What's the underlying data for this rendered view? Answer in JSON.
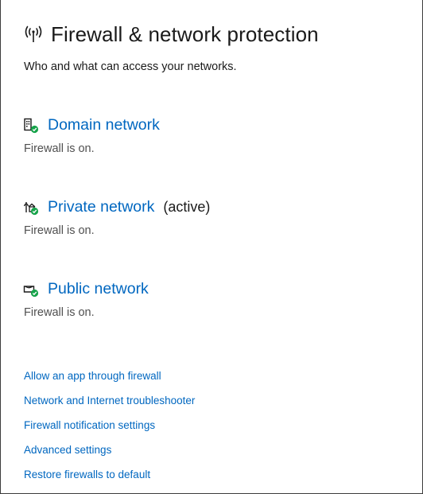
{
  "header": {
    "title": "Firewall & network protection",
    "subtitle": "Who and what can access your networks.",
    "icon": "wifi-antenna-icon"
  },
  "networks": [
    {
      "name": "Domain network",
      "active_label": "",
      "status": "Firewall is on.",
      "icon": "domain-building-icon",
      "status_color": "#16a34a"
    },
    {
      "name": "Private network",
      "active_label": "(active)",
      "status": "Firewall is on.",
      "icon": "private-home-icon",
      "status_color": "#16a34a"
    },
    {
      "name": "Public network",
      "active_label": "",
      "status": "Firewall is on.",
      "icon": "public-bench-icon",
      "status_color": "#16a34a"
    }
  ],
  "links": [
    "Allow an app through firewall",
    "Network and Internet troubleshooter",
    "Firewall notification settings",
    "Advanced settings",
    "Restore firewalls to default"
  ],
  "colors": {
    "link": "#0067c0",
    "text": "#1a1a1a",
    "muted": "#505050",
    "ok": "#16a34a"
  }
}
